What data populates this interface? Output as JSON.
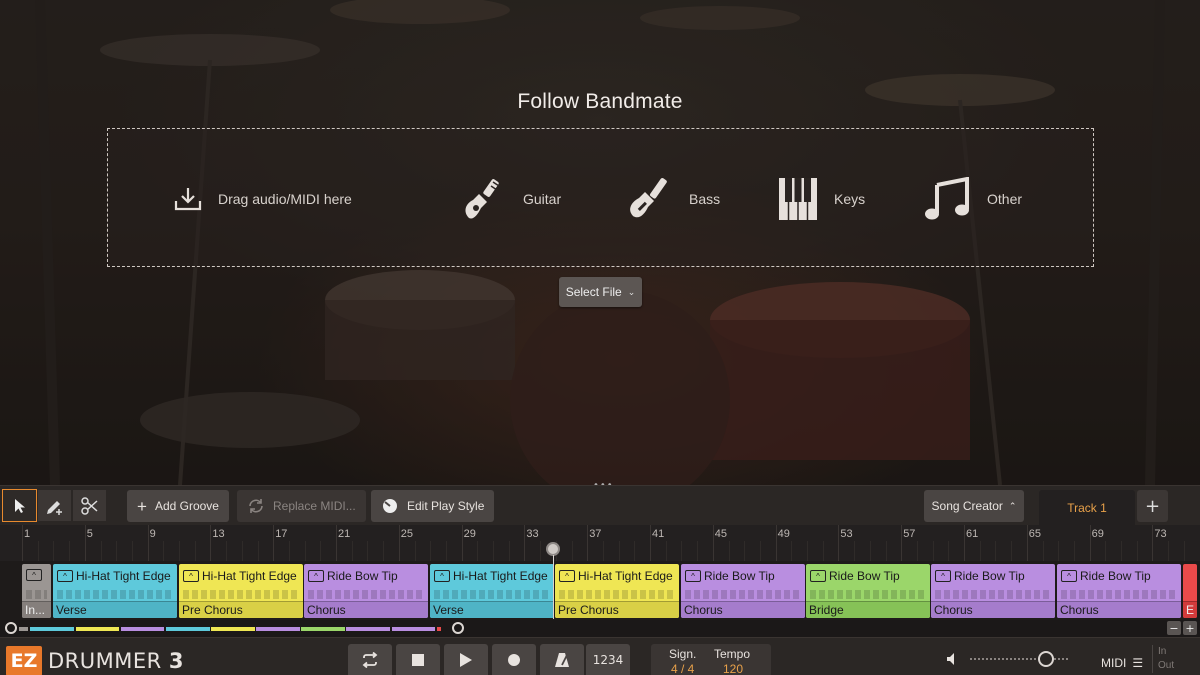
{
  "follow_bandmate": {
    "title": "Follow Bandmate",
    "drag_label": "Drag audio/MIDI here",
    "instruments": [
      {
        "label": "Guitar",
        "icon": "guitar-icon"
      },
      {
        "label": "Bass",
        "icon": "bass-icon"
      },
      {
        "label": "Keys",
        "icon": "keys-icon"
      },
      {
        "label": "Other",
        "icon": "music-note-icon"
      }
    ],
    "select_file_label": "Select File"
  },
  "toolbar": {
    "tools": [
      "pointer-tool-icon",
      "pencil-tool-icon",
      "scissors-tool-icon"
    ],
    "add_groove_label": "Add Groove",
    "replace_midi_label": "Replace MIDI...",
    "edit_play_style_label": "Edit Play Style",
    "song_creator_label": "Song Creator",
    "track_tab_label": "Track 1",
    "add_track_label": "+"
  },
  "ruler": {
    "bar_numbers": [
      "1",
      "5",
      "9",
      "13",
      "17",
      "21",
      "25",
      "29",
      "33",
      "37",
      "41",
      "45",
      "49",
      "53",
      "57",
      "61",
      "65",
      "69",
      "73"
    ]
  },
  "clips": [
    {
      "title": "",
      "part": "In...",
      "color": "grey"
    },
    {
      "title": "Hi-Hat Tight Edge",
      "part": "Verse",
      "color": "blue"
    },
    {
      "title": "Hi-Hat Tight Edge",
      "part": "Pre Chorus",
      "color": "yellow"
    },
    {
      "title": "Ride Bow Tip",
      "part": "Chorus",
      "color": "purple"
    },
    {
      "title": "Hi-Hat Tight Edge",
      "part": "Verse",
      "color": "blue"
    },
    {
      "title": "Hi-Hat Tight Edge",
      "part": "Pre Chorus",
      "color": "yellow"
    },
    {
      "title": "Ride Bow Tip",
      "part": "Chorus",
      "color": "purple"
    },
    {
      "title": "Ride Bow Tip",
      "part": "Bridge",
      "color": "green"
    },
    {
      "title": "Ride Bow Tip",
      "part": "Chorus",
      "color": "purple"
    },
    {
      "title": "Ride Bow Tip",
      "part": "Chorus",
      "color": "purple"
    },
    {
      "title": "",
      "part": "E",
      "color": "red"
    }
  ],
  "overview": {
    "zoom_out_label": "−",
    "zoom_in_label": "+"
  },
  "transport": {
    "logo_ez": "EZ",
    "logo_name": "DRUMMER",
    "logo_version": "3",
    "count_in_label": "1234",
    "signature_label": "Sign.",
    "signature_value": "4 / 4",
    "tempo_label": "Tempo",
    "tempo_value": "120",
    "midi_label": "MIDI",
    "in_label": "In",
    "out_label": "Out"
  },
  "colors": {
    "accent": "#e8782a",
    "blue": "#5ec9db",
    "yellow": "#efe654",
    "purple": "#b98ee0",
    "green": "#9bd66a",
    "grey": "#9b9693",
    "red": "#e94a4a"
  }
}
